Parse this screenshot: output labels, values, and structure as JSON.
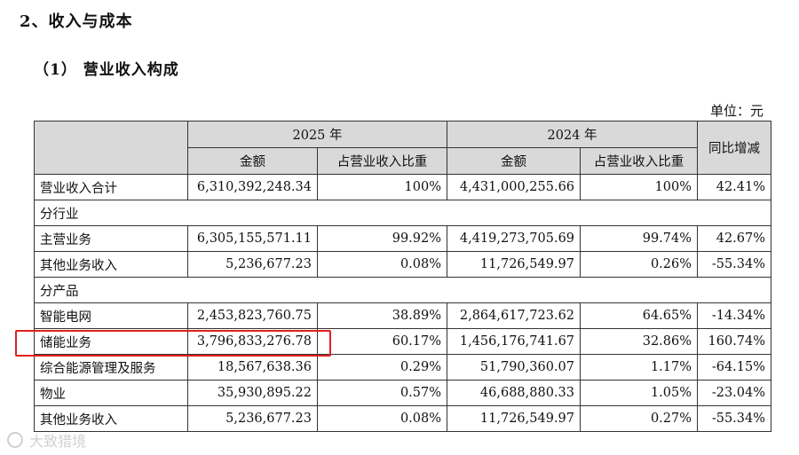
{
  "heading": "2、收入与成本",
  "subheading": "（1） 营业收入构成",
  "unit_label": "单位：元",
  "table": {
    "header": {
      "year_2025": "2025 年",
      "year_2024": "2024 年",
      "yoy": "同比增减",
      "amount": "金额",
      "share": "占营业收入比重"
    },
    "rows": [
      {
        "type": "data",
        "name": "营业收入合计",
        "amt25": "6,310,392,248.34",
        "pct25": "100%",
        "amt24": "4,431,000,255.66",
        "pct24": "100%",
        "yoy": "42.41%"
      },
      {
        "type": "section",
        "name": "分行业"
      },
      {
        "type": "data",
        "name": "主营业务",
        "amt25": "6,305,155,571.11",
        "pct25": "99.92%",
        "amt24": "4,419,273,705.69",
        "pct24": "99.74%",
        "yoy": "42.67%"
      },
      {
        "type": "data",
        "name": "其他业务收入",
        "amt25": "5,236,677.23",
        "pct25": "0.08%",
        "amt24": "11,726,549.97",
        "pct24": "0.26%",
        "yoy": "-55.34%"
      },
      {
        "type": "section",
        "name": "分产品"
      },
      {
        "type": "data",
        "name": "智能电网",
        "amt25": "2,453,823,760.75",
        "pct25": "38.89%",
        "amt24": "2,864,617,723.62",
        "pct24": "64.65%",
        "yoy": "-14.34%"
      },
      {
        "type": "data",
        "name": "储能业务",
        "amt25": "3,796,833,276.78",
        "pct25": "60.17%",
        "amt24": "1,456,176,741.67",
        "pct24": "32.86%",
        "yoy": "160.74%"
      },
      {
        "type": "data",
        "name": "综合能源管理及服务",
        "amt25": "18,567,638.36",
        "pct25": "0.29%",
        "amt24": "51,790,360.07",
        "pct24": "1.17%",
        "yoy": "-64.15%"
      },
      {
        "type": "data",
        "name": "物业",
        "amt25": "35,930,895.22",
        "pct25": "0.57%",
        "amt24": "46,688,880.33",
        "pct24": "1.05%",
        "yoy": "-23.04%"
      },
      {
        "type": "data",
        "name": "其他业务收入",
        "amt25": "5,236,677.23",
        "pct25": "0.08%",
        "amt24": "11,726,549.97",
        "pct24": "0.27%",
        "yoy": "-55.34%"
      }
    ]
  },
  "highlight_color": "#e02020",
  "watermark": "大致猎境"
}
